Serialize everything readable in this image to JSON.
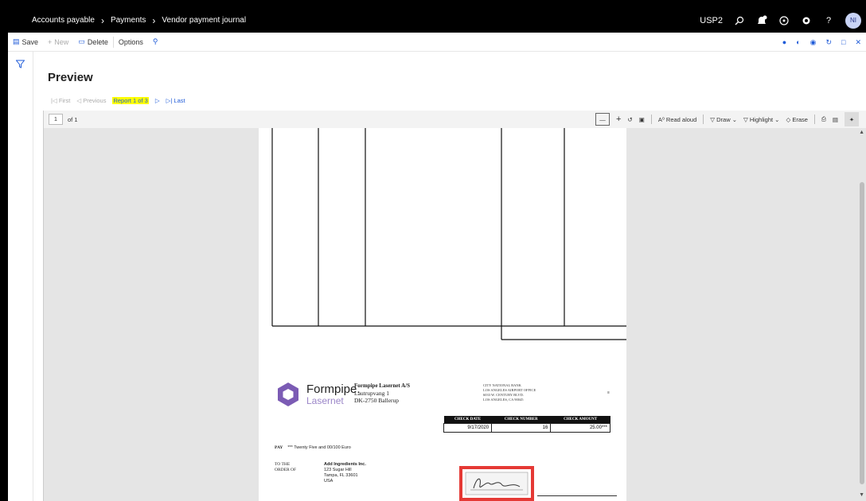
{
  "topbar": {
    "breadcrumbs": [
      "Accounts payable",
      "Payments",
      "Vendor payment journal"
    ],
    "company": "USP2",
    "avatar_initials": "NI"
  },
  "actions": {
    "save": "Save",
    "new": "New",
    "delete": "Delete",
    "options": "Options"
  },
  "page": {
    "title": "Preview"
  },
  "report_nav": {
    "first": "First",
    "previous": "Previous",
    "current": "Report 1 of 3",
    "last": "Last"
  },
  "viewer": {
    "page_input": "1",
    "page_count": "of 1",
    "read_aloud": "Read aloud",
    "draw": "Draw",
    "highlight": "Highlight",
    "erase": "Erase"
  },
  "document": {
    "logo_word1": "Formpipe.",
    "logo_word2": "Lasernet",
    "company_name": "Formpipe Lasernet A/S",
    "company_addr1": "Lautrupvang 1",
    "company_addr2": "DK-2750 Ballerup",
    "bank_lines": [
      "CITY NATIONAL BANK",
      "LOS ANGELES AIRPORT OFFICE",
      "6033 W. CENTURY BLVD.",
      "LOS ANGELES, CA 90045"
    ],
    "check_headers": [
      "CHECK DATE",
      "CHECK NUMBER",
      "CHECK AMOUNT"
    ],
    "check_values": [
      "9/17/2020",
      "16",
      "25.00***"
    ],
    "pay_label": "PAY",
    "pay_amount_text": "*** Twenty Five and 00/100 Euro",
    "to_the": "TO THE",
    "order_of": "ORDER OF",
    "payee_name": "Add Ingredients Inc.",
    "payee_line1": "123 Sugar Hill",
    "payee_line2": "Tampa, FL 33601",
    "payee_line3": "USA"
  },
  "colors": {
    "accent": "#1f5bd8",
    "highlight": "#ffff00",
    "signature_box": "#e53935",
    "logo_purple": "#7b5bb4"
  }
}
